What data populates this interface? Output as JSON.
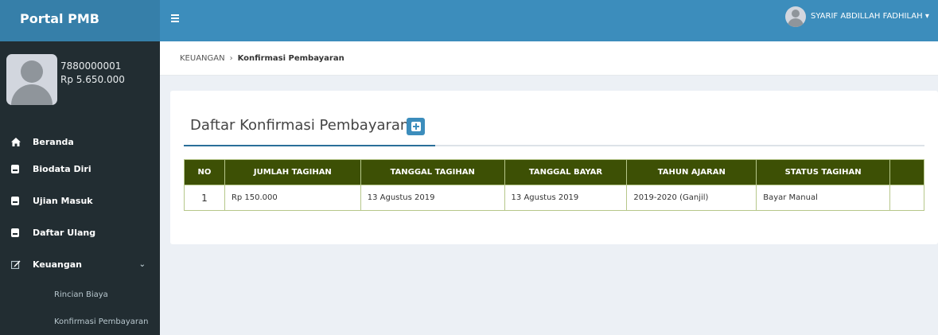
{
  "app": {
    "brand": "Portal PMB"
  },
  "user": {
    "id": "7880000001",
    "balance": "Rp 5.650.000",
    "name": "SYARIF ABDILLAH FADHILAH"
  },
  "topbar": {
    "dropdown_caret": "▾"
  },
  "sidebar": {
    "items": [
      {
        "label": "Beranda",
        "icon": "home-icon"
      },
      {
        "label": "Biodata Diri",
        "icon": "book-icon"
      },
      {
        "label": "Ujian Masuk",
        "icon": "book-icon"
      },
      {
        "label": "Daftar Ulang",
        "icon": "book-icon"
      },
      {
        "label": "Keuangan",
        "icon": "edit-icon",
        "chevron": "⌄"
      }
    ],
    "subitems": [
      {
        "label": "Rincian Biaya"
      },
      {
        "label": "Konfirmasi Pembayaran"
      }
    ]
  },
  "breadcrumb": {
    "parent": "KEUANGAN",
    "separator": "›",
    "current": "Konfirmasi Pembayaran"
  },
  "main": {
    "title": "Daftar Konfirmasi Pembayaran",
    "table": {
      "headers": [
        "NO",
        "JUMLAH TAGIHAN",
        "TANGGAL TAGIHAN",
        "TANGGAL BAYAR",
        "TAHUN AJARAN",
        "STATUS TAGIHAN",
        ""
      ],
      "rows": [
        [
          "1",
          "Rp 150.000",
          "13 Agustus 2019",
          "13 Agustus 2019",
          "2019-2020 (Ganjil)",
          "Bayar Manual",
          ""
        ]
      ]
    }
  },
  "colors": {
    "sidebar": "#222d32",
    "header": "#3c8dbc",
    "brand": "#367fa9",
    "table_header": "#3d5005"
  }
}
